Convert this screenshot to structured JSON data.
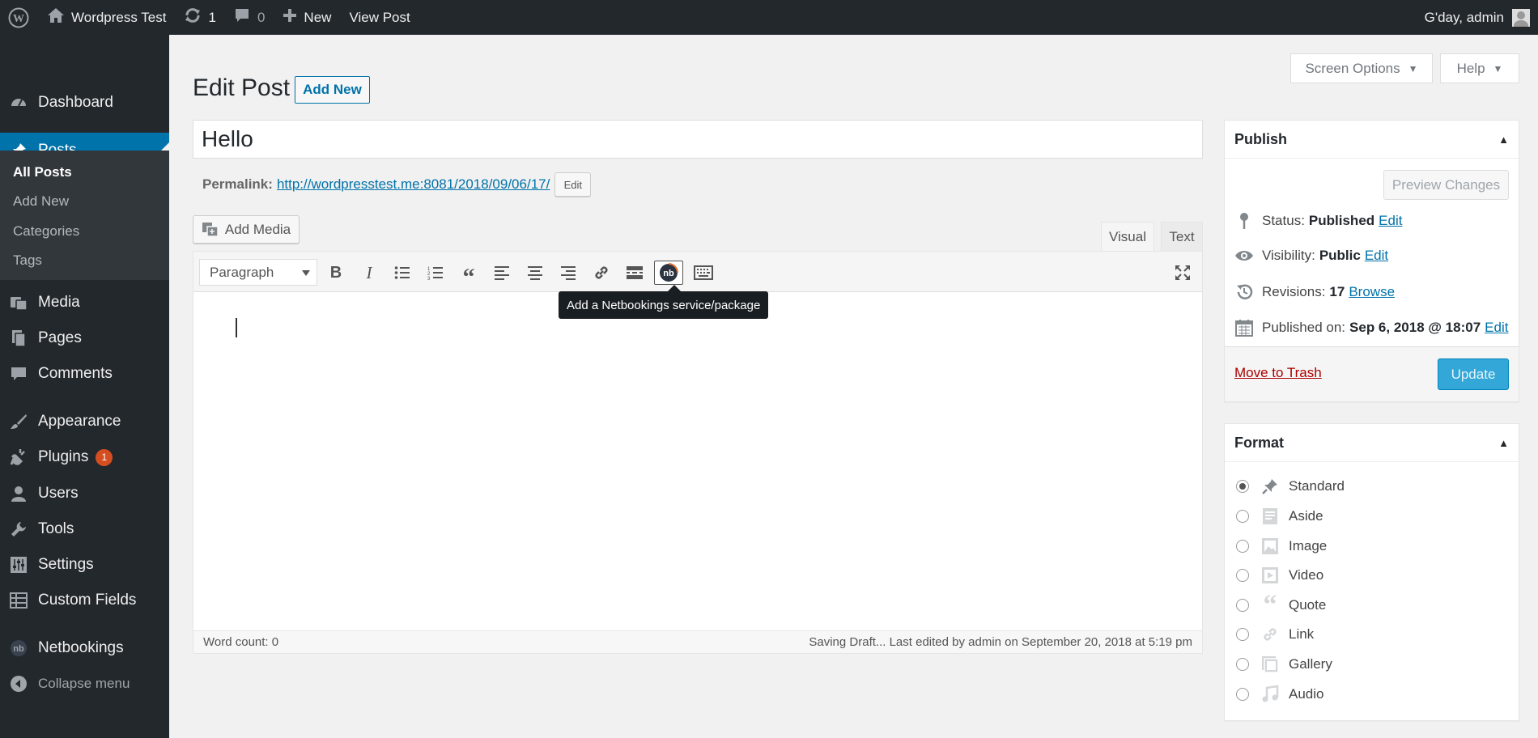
{
  "admin_bar": {
    "site_name": "Wordpress Test",
    "updates_count": "1",
    "comments_count": "0",
    "new_label": "New",
    "view_post_label": "View Post",
    "greeting": "G'day, admin"
  },
  "sidebar": {
    "items": [
      {
        "label": "Dashboard"
      },
      {
        "label": "Posts"
      },
      {
        "label": "Media"
      },
      {
        "label": "Pages"
      },
      {
        "label": "Comments"
      },
      {
        "label": "Appearance"
      },
      {
        "label": "Plugins",
        "badge": "1"
      },
      {
        "label": "Users"
      },
      {
        "label": "Tools"
      },
      {
        "label": "Settings"
      },
      {
        "label": "Custom Fields"
      },
      {
        "label": "Netbookings"
      }
    ],
    "submenu": [
      "All Posts",
      "Add New",
      "Categories",
      "Tags"
    ],
    "collapse_label": "Collapse menu"
  },
  "screen_options_label": "Screen Options",
  "help_label": "Help",
  "page": {
    "title": "Edit Post",
    "add_new_label": "Add New",
    "post_title": "Hello",
    "permalink_label": "Permalink:",
    "permalink_url": "http://wordpresstest.me:8081/2018/09/06/17/",
    "permalink_edit": "Edit"
  },
  "editor": {
    "add_media_label": "Add Media",
    "tab_visual": "Visual",
    "tab_text": "Text",
    "format_selected": "Paragraph",
    "tooltip": "Add a Netbookings service/package",
    "word_count": "Word count: 0",
    "status": "Saving Draft... Last edited by admin on September 20, 2018 at 5:19 pm"
  },
  "publish": {
    "title": "Publish",
    "preview_label": "Preview Changes",
    "status_label": "Status:",
    "status_value": "Published",
    "visibility_label": "Visibility:",
    "visibility_value": "Public",
    "revisions_label": "Revisions:",
    "revisions_value": "17",
    "browse_label": "Browse",
    "published_label": "Published on:",
    "published_value": "Sep 6, 2018 @ 18:07",
    "edit_label": "Edit",
    "trash_label": "Move to Trash",
    "update_label": "Update"
  },
  "format": {
    "title": "Format",
    "options": [
      "Standard",
      "Aside",
      "Image",
      "Video",
      "Quote",
      "Link",
      "Gallery",
      "Audio"
    ],
    "selected": "Standard"
  },
  "colors": {
    "admin_dark": "#23282d",
    "accent": "#0073aa",
    "update_button": "#33a8d8",
    "badge": "#d54e21"
  }
}
